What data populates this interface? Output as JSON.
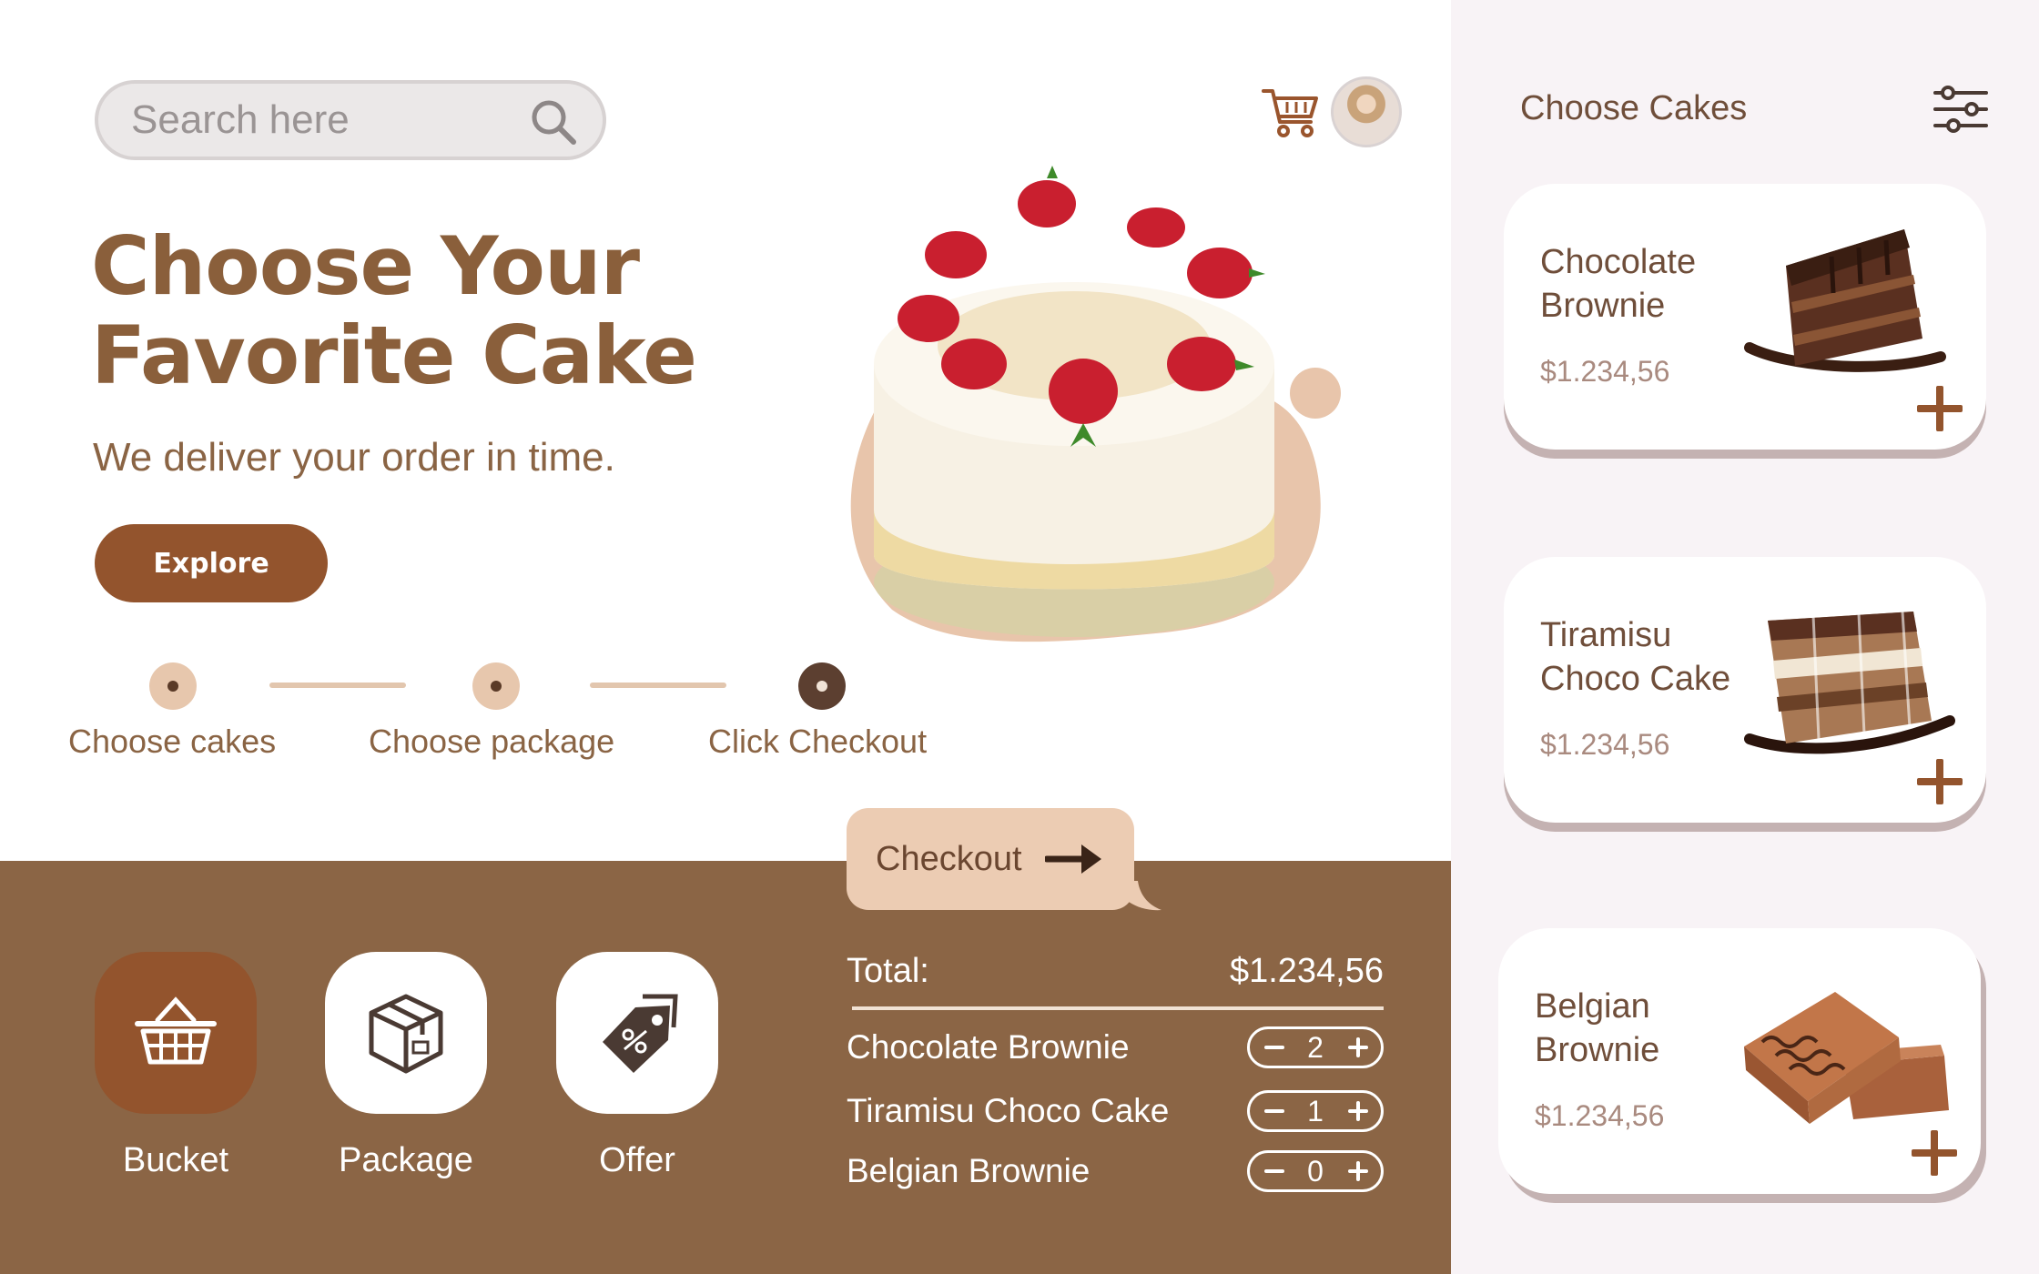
{
  "search": {
    "placeholder": "Search here"
  },
  "header": {
    "cart_icon": "cart-icon",
    "avatar": "user-avatar"
  },
  "hero": {
    "title_line1": "Choose Your",
    "title_line2": "Favorite Cake",
    "subtitle": "We deliver your order in time.",
    "explore_label": "Explore"
  },
  "steps": [
    {
      "label": "Choose cakes",
      "active": false
    },
    {
      "label": "Choose package",
      "active": false
    },
    {
      "label": "Click Checkout",
      "active": true
    }
  ],
  "checkout": {
    "label": "Checkout"
  },
  "categories": [
    {
      "label": "Bucket",
      "icon": "basket-icon",
      "active": true
    },
    {
      "label": "Package",
      "icon": "box-icon",
      "active": false
    },
    {
      "label": "Offer",
      "icon": "discount-tag-icon",
      "active": false
    }
  ],
  "order": {
    "total_label": "Total:",
    "total_value": "$1.234,56",
    "items": [
      {
        "name": "Chocolate Brownie",
        "qty": "2"
      },
      {
        "name": "Tiramisu Choco Cake",
        "qty": "1"
      },
      {
        "name": "Belgian Brownie",
        "qty": "0"
      }
    ]
  },
  "sidebar": {
    "title": "Choose Cakes",
    "filter_icon": "filter-sliders-icon",
    "cards": [
      {
        "name_line1": "Chocolate",
        "name_line2": "Brownie",
        "price": "$1.234,56"
      },
      {
        "name_line1": "Tiramisu",
        "name_line2": "Choco Cake",
        "price": "$1.234,56"
      },
      {
        "name_line1": "Belgian",
        "name_line2": "Brownie",
        "price": "$1.234,56"
      }
    ]
  },
  "colors": {
    "brand_brown": "#8a5f3b",
    "accent_rust": "#93542d",
    "band_brown": "#8b6545",
    "peach": "#ecccb3",
    "sidebar_bg": "#f8f3f6"
  }
}
